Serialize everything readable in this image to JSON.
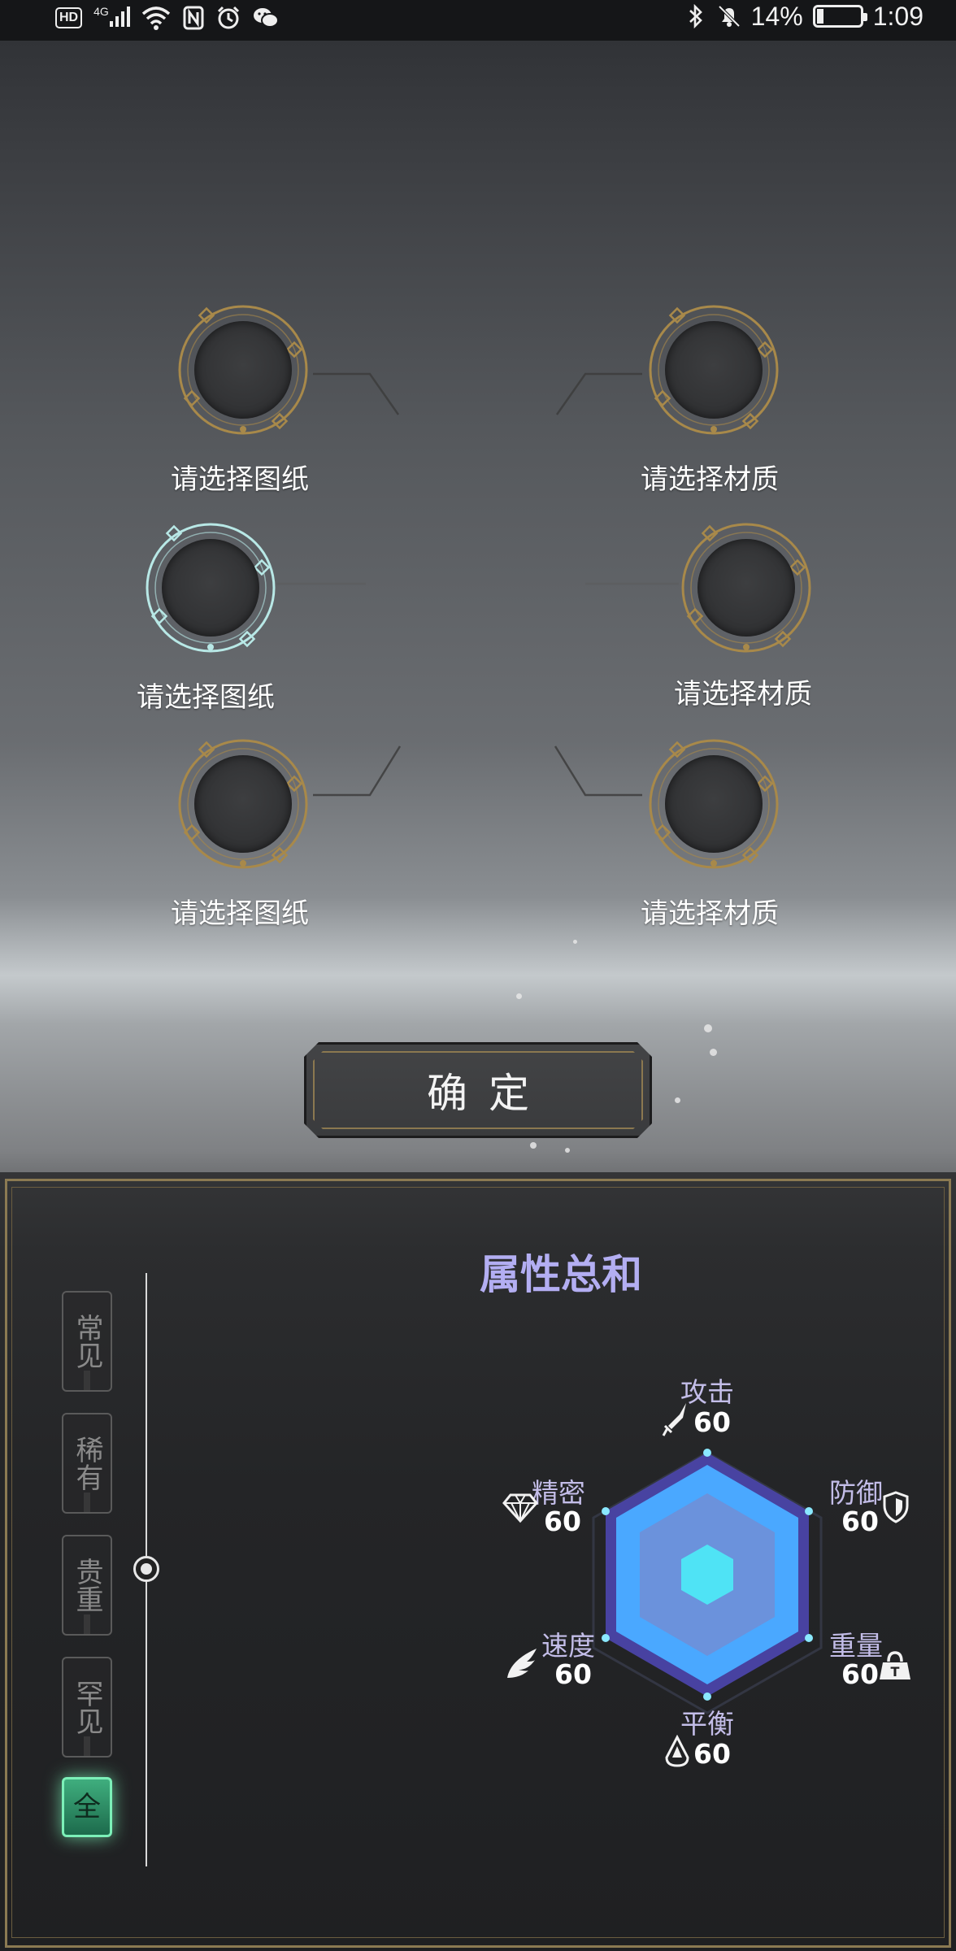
{
  "status_bar": {
    "network": "4G",
    "hd_badge": "HD",
    "battery_percent": "14%",
    "battery_level": 0.14,
    "time": "1:09"
  },
  "slots": [
    {
      "label": "请选择图纸",
      "type": "blueprint",
      "selected": false
    },
    {
      "label": "请选择材质",
      "type": "material",
      "selected": false
    },
    {
      "label": "请选择图纸",
      "type": "blueprint",
      "selected": true
    },
    {
      "label": "请选择材质",
      "type": "material",
      "selected": false
    },
    {
      "label": "请选择图纸",
      "type": "blueprint",
      "selected": false
    },
    {
      "label": "请选择材质",
      "type": "material",
      "selected": false
    }
  ],
  "confirm_label": "确定",
  "filters": [
    {
      "label": "常见",
      "active": false
    },
    {
      "label": "稀有",
      "active": false
    },
    {
      "label": "贵重",
      "active": false
    },
    {
      "label": "罕见",
      "active": false
    },
    {
      "label": "全",
      "active": true
    }
  ],
  "attributes": {
    "title": "属性总和",
    "stats": [
      {
        "name": "攻击",
        "value": 60,
        "icon": "sword-icon"
      },
      {
        "name": "防御",
        "value": 60,
        "icon": "shield-icon"
      },
      {
        "name": "重量",
        "value": 60,
        "icon": "weight-icon"
      },
      {
        "name": "平衡",
        "value": 60,
        "icon": "balance-icon"
      },
      {
        "name": "速度",
        "value": 60,
        "icon": "wing-icon"
      },
      {
        "name": "精密",
        "value": 60,
        "icon": "diamond-icon"
      }
    ]
  },
  "colors": {
    "accent_purple": "#b3aef2",
    "gold_frame": "#8b7a52",
    "active_green": "#3fae7e",
    "radar_blue": "#4aa8ff"
  }
}
